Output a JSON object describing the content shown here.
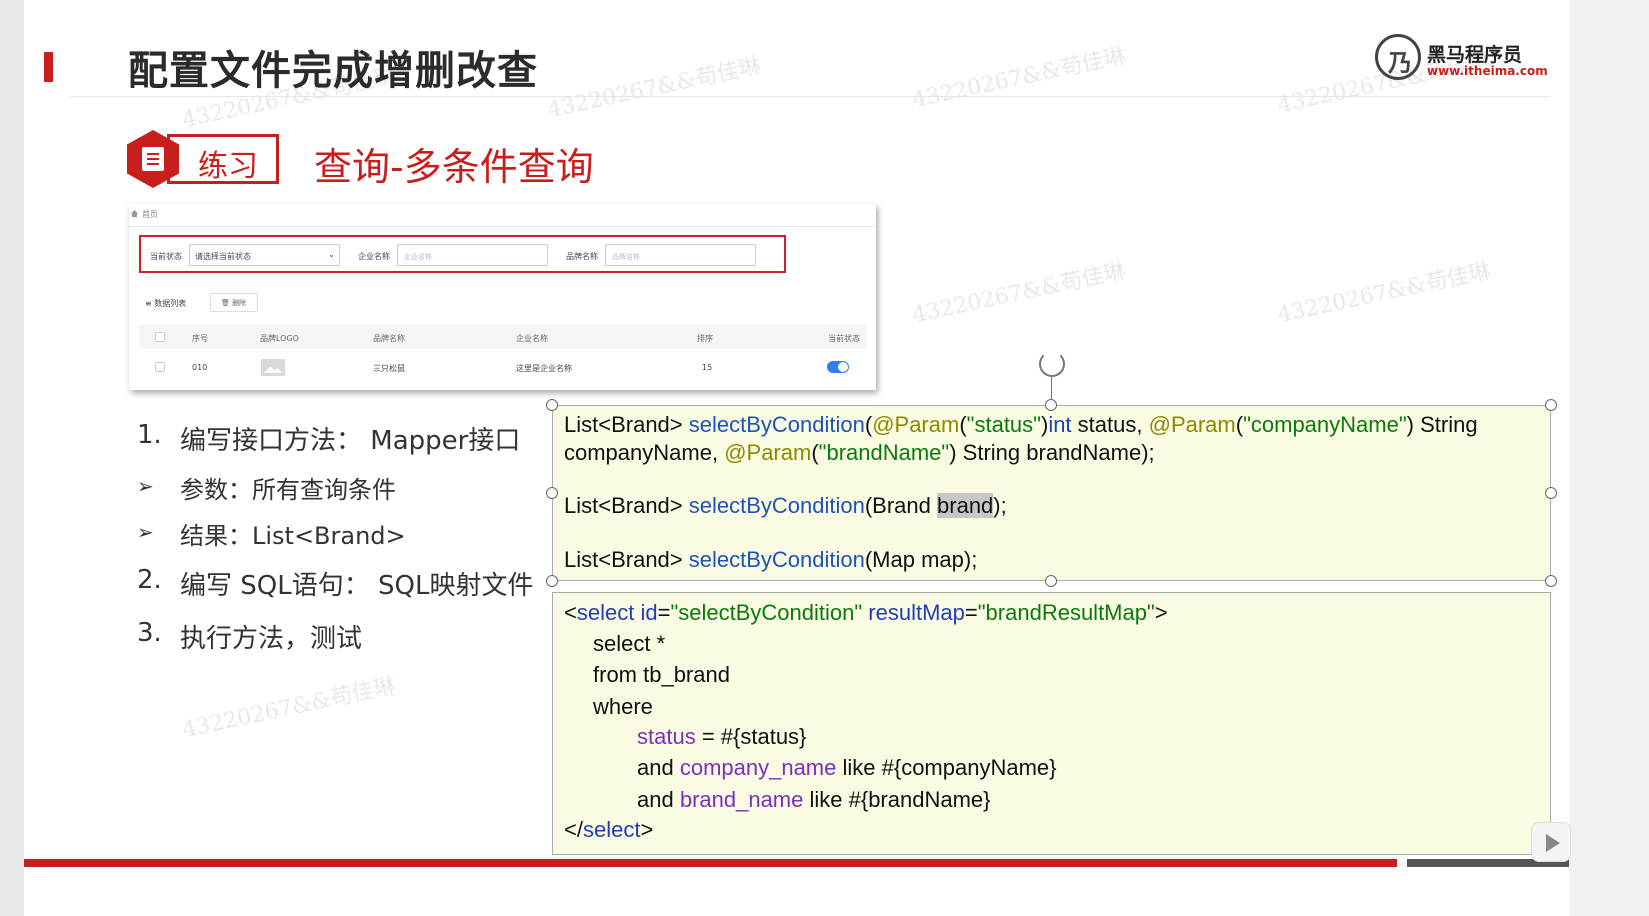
{
  "slide": {
    "title": "配置文件完成增删改查",
    "logo": {
      "name": "黑马程序员",
      "url": "www.itheima.com"
    },
    "badge_label": "练习",
    "subtitle": "查询-多条件查询",
    "watermark": "43220267&&苟佳琳"
  },
  "screenshot": {
    "breadcrumb": "首页",
    "filters": [
      {
        "label": "当前状态",
        "value": "请选择当前状态"
      },
      {
        "label": "企业名称",
        "placeholder": "企业名称"
      },
      {
        "label": "品牌名称",
        "placeholder": "品牌名称"
      }
    ],
    "list_title": "数据列表",
    "delete_label": "删除",
    "columns": [
      "序号",
      "品牌LOGO",
      "品牌名称",
      "企业名称",
      "排序",
      "当前状态"
    ],
    "row": {
      "id": "010",
      "brand_name": "三只松鼠",
      "company_name": "这里是企业名称",
      "ordered": "15",
      "status_on": true
    }
  },
  "steps": {
    "s1": {
      "num": "1.",
      "text": "编写接口方法：  Mapper接口"
    },
    "b1": "参数：所有查询条件",
    "b2": "结果：List<Brand>",
    "s2": {
      "num": "2.",
      "text": "编写 SQL语句：  SQL映射文件"
    },
    "s3": {
      "num": "3.",
      "text": "执行方法，测试"
    }
  },
  "code1": {
    "l1": [
      "List<Brand> ",
      "selectByCondition",
      "(",
      "@Param",
      "(",
      "\"status\"",
      ")",
      "int",
      " status, ",
      "@Param",
      "(",
      "\"companyName\"",
      ") String"
    ],
    "l2": [
      "companyName, ",
      "@Param",
      "(",
      "\"brandName\"",
      ") String brandName);"
    ],
    "l3": [
      "List<Brand> ",
      "selectByCondition",
      "(Brand ",
      "brand",
      ");"
    ],
    "l4": [
      "List<Brand> ",
      "selectByCondition",
      "(Map map);"
    ]
  },
  "code2": {
    "l1": [
      "<",
      "select",
      " ",
      "id",
      "=",
      "\"selectByCondition\"",
      " ",
      "resultMap",
      "=",
      "\"brandResultMap\"",
      ">"
    ],
    "l2": "select *",
    "l3": "from tb_brand",
    "l4": "where",
    "l5": [
      "status",
      " = #{status}"
    ],
    "l6": [
      "and ",
      "company_name",
      " like #{companyName}"
    ],
    "l7": [
      "and ",
      "brand_name",
      " like #{brandName}"
    ],
    "l8": [
      "</",
      "select",
      ">"
    ]
  }
}
